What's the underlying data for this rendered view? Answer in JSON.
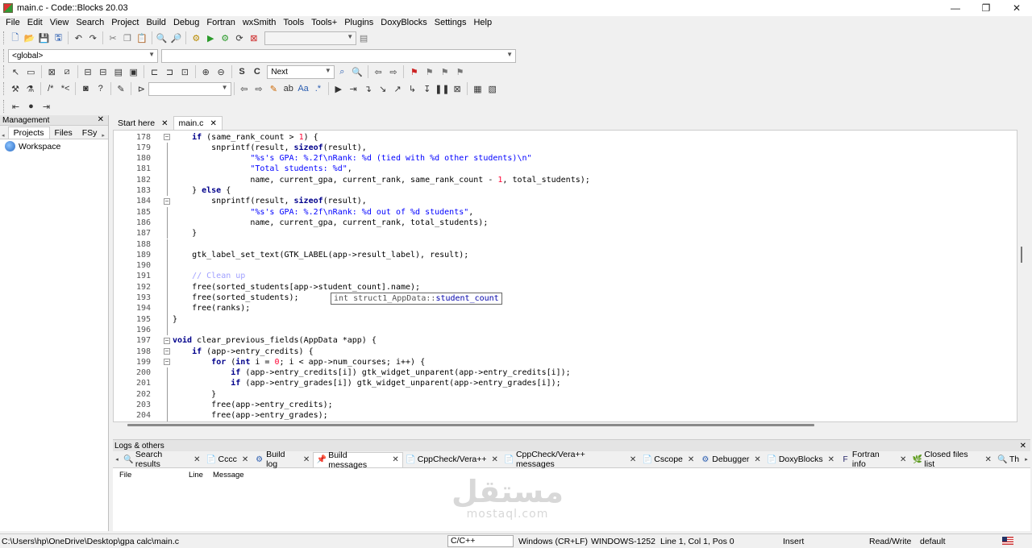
{
  "window": {
    "title": "main.c - Code::Blocks 20.03",
    "minimize": "—",
    "maximize": "❐",
    "close": "✕"
  },
  "menu": [
    "File",
    "Edit",
    "View",
    "Search",
    "Project",
    "Build",
    "Debug",
    "Fortran",
    "wxSmith",
    "Tools",
    "Tools+",
    "Plugins",
    "DoxyBlocks",
    "Settings",
    "Help"
  ],
  "toolbar": {
    "scope_combo": "<global>",
    "function_combo": "",
    "search_combo": "Next",
    "target_combo": ""
  },
  "management": {
    "title": "Management",
    "tabs": [
      "Projects",
      "Files",
      "FSy"
    ],
    "workspace": "Workspace"
  },
  "editor": {
    "tabs": [
      {
        "label": "Start here",
        "active": false
      },
      {
        "label": "main.c",
        "active": true
      }
    ],
    "calltip": "int struct1_AppData::student_count",
    "lines": [
      {
        "n": "178",
        "text": "    if (same_rank_count > 1) {"
      },
      {
        "n": "179",
        "text": "        snprintf(result, sizeof(result),"
      },
      {
        "n": "180",
        "text": "                \"%s's GPA: %.2f\\nRank: %d (tied with %d other students)\\n\""
      },
      {
        "n": "181",
        "text": "                \"Total students: %d\","
      },
      {
        "n": "182",
        "text": "                name, current_gpa, current_rank, same_rank_count - 1, total_students);"
      },
      {
        "n": "183",
        "text": "    } else {"
      },
      {
        "n": "184",
        "text": "        snprintf(result, sizeof(result),"
      },
      {
        "n": "185",
        "text": "                \"%s's GPA: %.2f\\nRank: %d out of %d students\","
      },
      {
        "n": "186",
        "text": "                name, current_gpa, current_rank, total_students);"
      },
      {
        "n": "187",
        "text": "    }"
      },
      {
        "n": "188",
        "text": ""
      },
      {
        "n": "189",
        "text": "    gtk_label_set_text(GTK_LABEL(app->result_label), result);"
      },
      {
        "n": "190",
        "text": ""
      },
      {
        "n": "191",
        "text": "    // Clean up"
      },
      {
        "n": "192",
        "text": "    free(sorted_students[app->student_count].name);"
      },
      {
        "n": "193",
        "text": "    free(sorted_students);"
      },
      {
        "n": "194",
        "text": "    free(ranks);"
      },
      {
        "n": "195",
        "text": "}"
      },
      {
        "n": "196",
        "text": ""
      },
      {
        "n": "197",
        "text": "void clear_previous_fields(AppData *app) {"
      },
      {
        "n": "198",
        "text": "    if (app->entry_credits) {"
      },
      {
        "n": "199",
        "text": "        for (int i = 0; i < app->num_courses; i++) {"
      },
      {
        "n": "200",
        "text": "            if (app->entry_credits[i]) gtk_widget_unparent(app->entry_credits[i]);"
      },
      {
        "n": "201",
        "text": "            if (app->entry_grades[i]) gtk_widget_unparent(app->entry_grades[i]);"
      },
      {
        "n": "202",
        "text": "        }"
      },
      {
        "n": "203",
        "text": "        free(app->entry_credits);"
      },
      {
        "n": "204",
        "text": "        free(app->entry_grades);"
      }
    ]
  },
  "logs": {
    "title": "Logs & others",
    "tabs": [
      {
        "label": "Search results",
        "icon": "search-icon"
      },
      {
        "label": "Cccc",
        "icon": "doc-icon"
      },
      {
        "label": "Build log",
        "icon": "gear-icon"
      },
      {
        "label": "Build messages",
        "icon": "pin-icon",
        "active": true
      },
      {
        "label": "CppCheck/Vera++",
        "icon": "doc-icon"
      },
      {
        "label": "CppCheck/Vera++ messages",
        "icon": "doc-icon"
      },
      {
        "label": "Cscope",
        "icon": "doc-icon"
      },
      {
        "label": "Debugger",
        "icon": "gear-icon"
      },
      {
        "label": "DoxyBlocks",
        "icon": "doc-icon"
      },
      {
        "label": "Fortran info",
        "icon": "fortran-icon"
      },
      {
        "label": "Closed files list",
        "icon": "tree-icon"
      },
      {
        "label": "Th",
        "icon": "search-icon"
      }
    ],
    "columns": [
      "File",
      "Line",
      "Message"
    ]
  },
  "watermark": {
    "arabic": "مستقل",
    "latin": "mostaql.com"
  },
  "status": {
    "path": "C:\\Users\\hp\\OneDrive\\Desktop\\gpa calc\\main.c",
    "language": "C/C++",
    "eol": "Windows (CR+LF)",
    "encoding": "WINDOWS-1252",
    "position": "Line 1, Col 1, Pos 0",
    "mode": "Insert",
    "access": "Read/Write",
    "profile": "default"
  }
}
